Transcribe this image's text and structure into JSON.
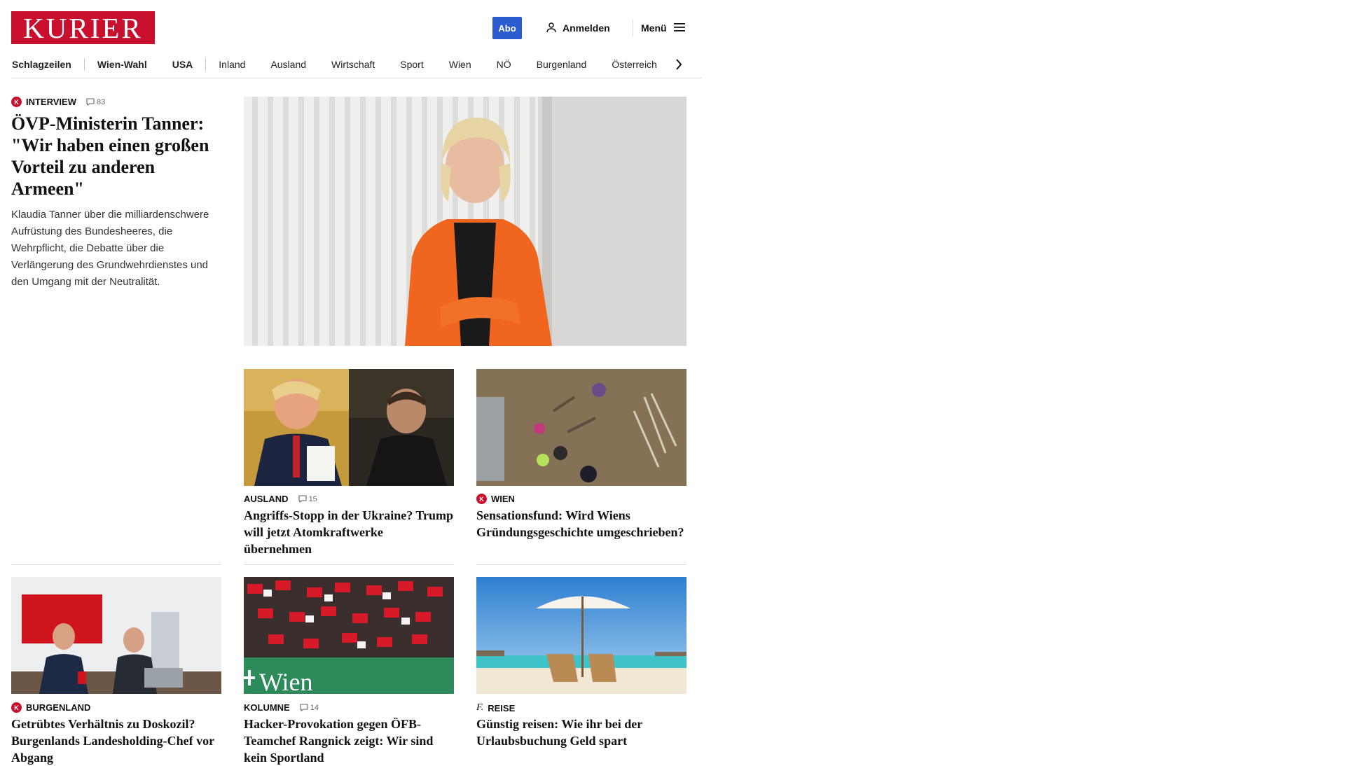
{
  "header": {
    "logo": "KURIER",
    "abo_label": "Abo",
    "login_label": "Anmelden",
    "menu_label": "Menü"
  },
  "nav": {
    "items": [
      "Schlagzeilen",
      "Wien-Wahl",
      "USA",
      "Inland",
      "Ausland",
      "Wirtschaft",
      "Sport",
      "Wien",
      "NÖ",
      "Burgenland",
      "Österreich"
    ]
  },
  "lead": {
    "kicker": "Interview",
    "comments": "83",
    "title": "ÖVP-Ministerin Tanner: \"Wir haben einen großen Vorteil zu anderen Armeen\"",
    "description": "Klaudia Tanner über die milliardenschwere Aufrüstung des Bundesheeres, die Wehrpflicht, die Debatte über die Verlängerung des Grundwehrdienstes und den Umgang mit der Neutralität."
  },
  "cards": [
    {
      "category": "Ausland",
      "comments": "15",
      "title": "Angriffs-Stopp in der Ukraine? Trump will jetzt Atomkraftwerke übernehmen"
    },
    {
      "category": "Wien",
      "title": "Sensationsfund: Wird Wiens Gründungsgeschichte umgeschrieben?"
    },
    {
      "category": "Burgenland",
      "title": "Getrübtes Verhältnis zu Doskozil? Burgenlands Landesholding-Chef vor Abgang"
    },
    {
      "category": "Kolumne",
      "comments": "14",
      "title": "Hacker-Provokation gegen ÖFB-Teamchef Rangnick zeigt: Wir sind kein Sportland"
    },
    {
      "category": "Reise",
      "title": "Günstig reisen: Wie ihr bei der Urlaubsbuchung Geld spart"
    }
  ],
  "badges": {
    "k": "K",
    "f": "f."
  },
  "image_text": {
    "wien_banner": "Wien"
  },
  "colors": {
    "brand": "#c8102e",
    "abo": "#2c5bd0"
  }
}
